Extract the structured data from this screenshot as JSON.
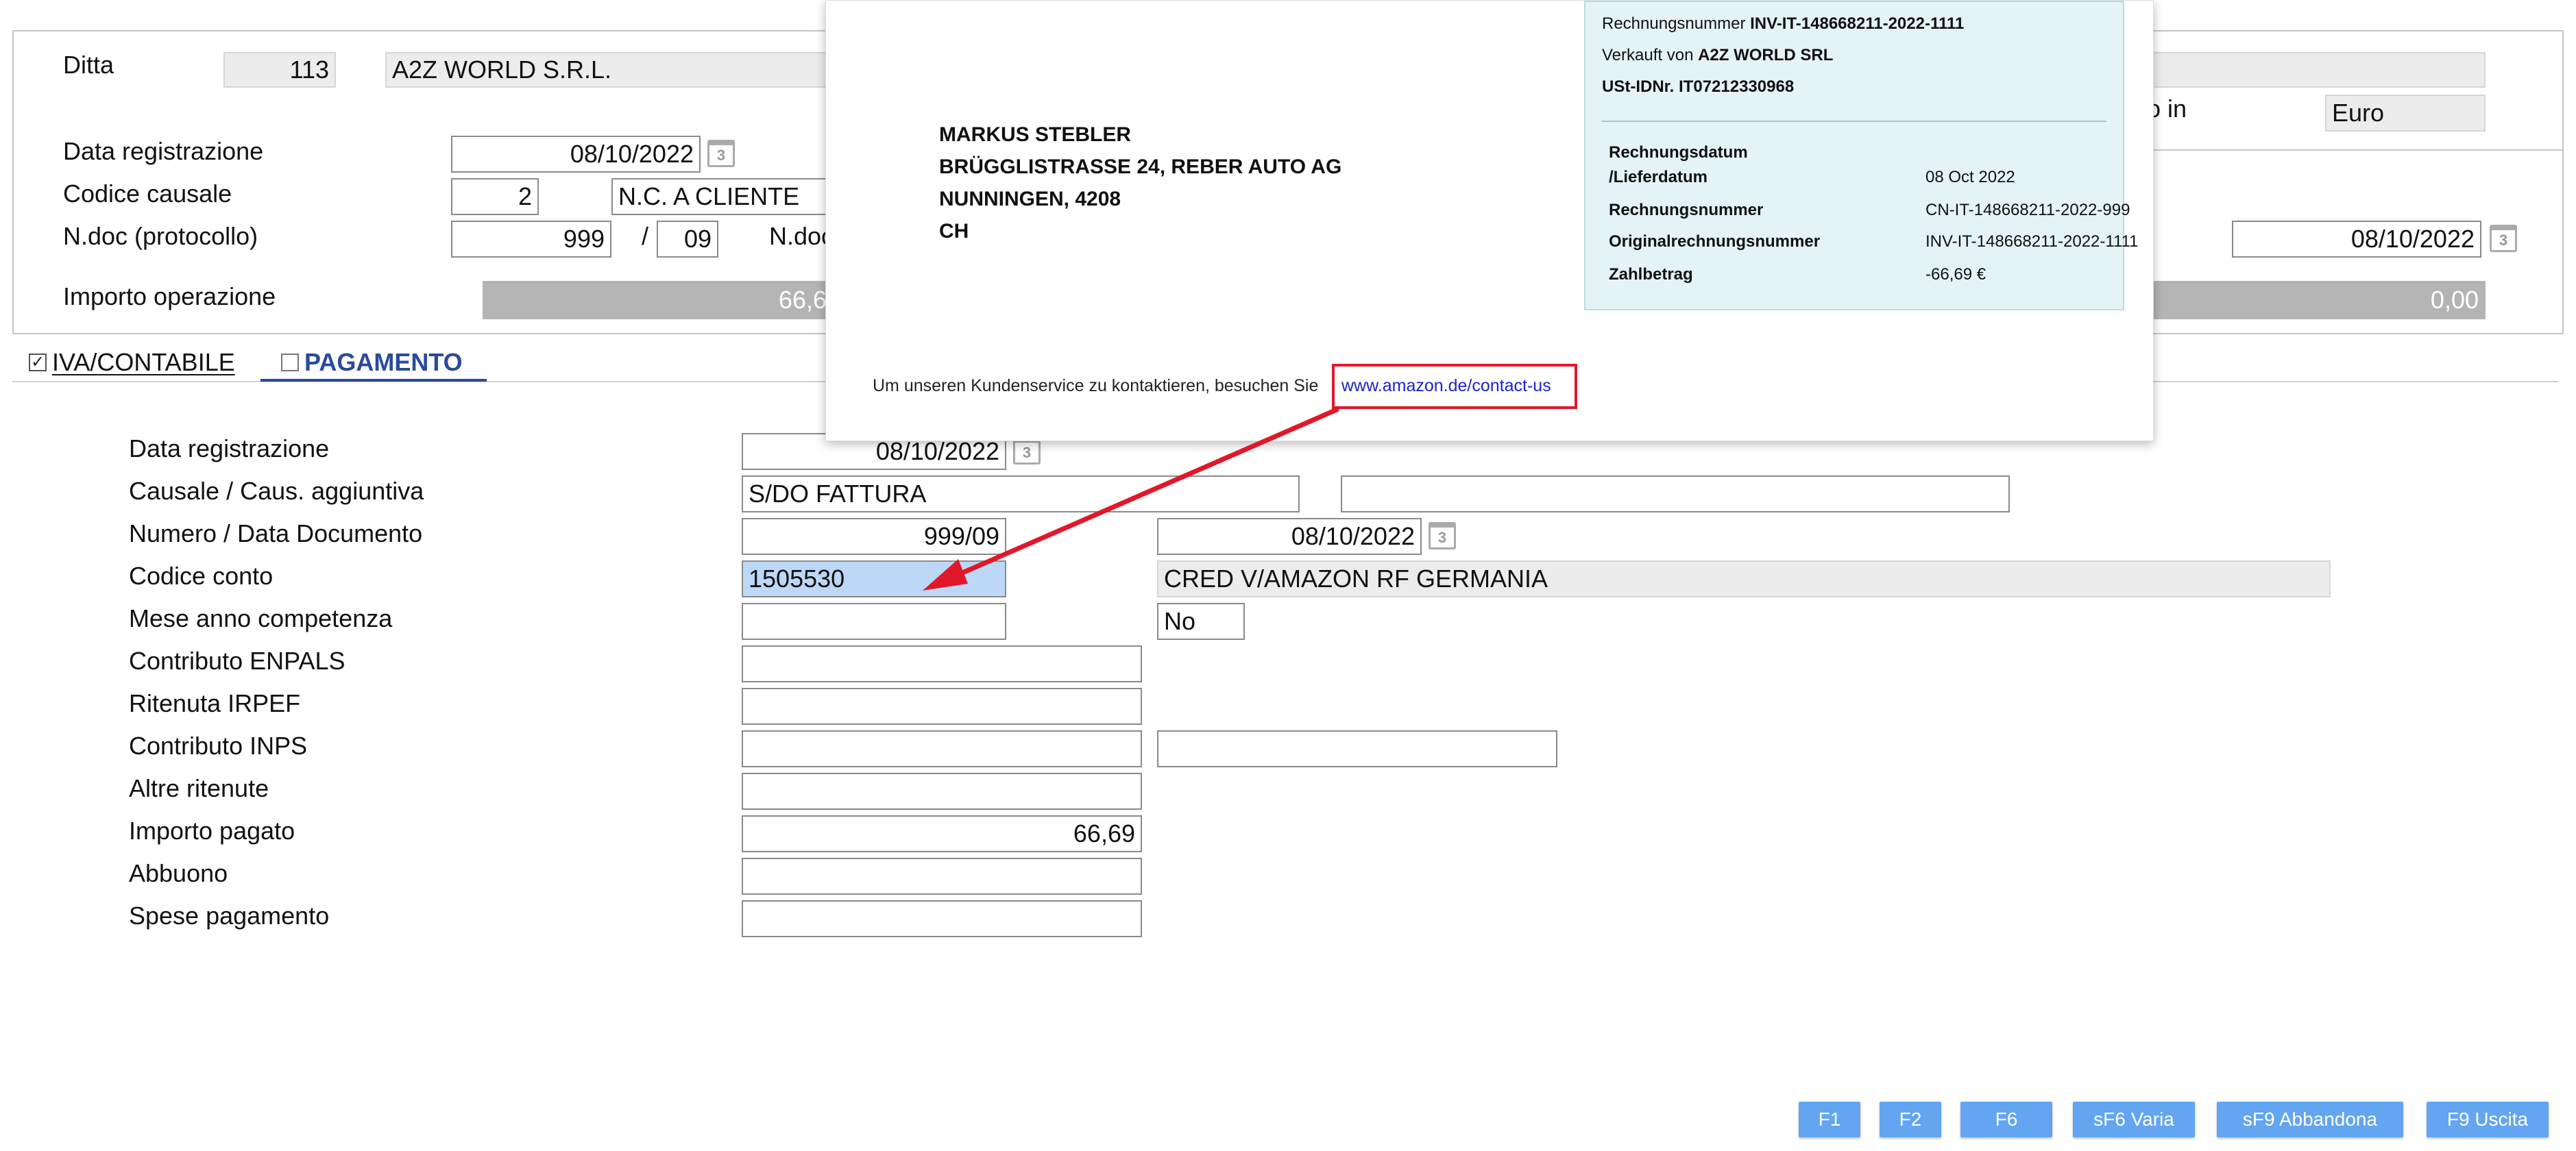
{
  "header": {
    "ditta_label": "Ditta",
    "ditta_code": "113",
    "ditta_name": "A2Z WORLD S.R.L.",
    "data_reg_label": "Data registrazione",
    "data_reg_value": "08/10/2022",
    "codice_causale_label": "Codice causale",
    "codice_causale_value": "2",
    "causale_desc": "N.C. A  CLIENTE",
    "ndoc_label": "N.doc (protocollo)",
    "ndoc_value": "999",
    "ndoc_sep": "/",
    "ndoc_suffix": "09",
    "ndoc_partial_label": "N.doc",
    "ndoc_date_value": "08/10/2022",
    "importo_label": "Importo operazione",
    "importo_value": "66,6",
    "importo_right_value": "0,00",
    "currency_label_partial": "o in",
    "currency_value": "Euro",
    "calendar_glyph": "3"
  },
  "tabs": [
    {
      "label": "IVA/CONTABILE",
      "checked": true
    },
    {
      "label": "PAGAMENTO",
      "checked": false,
      "active": true
    }
  ],
  "form": {
    "data_registrazione": {
      "label": "Data registrazione",
      "value": "08/10/2022"
    },
    "causale": {
      "label": "Causale / Caus. aggiuntiva",
      "value": "S/DO FATTURA",
      "value2": ""
    },
    "numero_data": {
      "label": "Numero / Data Documento",
      "value": "999/09",
      "date": "08/10/2022"
    },
    "codice_conto": {
      "label": "Codice conto",
      "value": "1505530",
      "desc": "CRED V/AMAZON RF GERMANIA"
    },
    "mese_anno": {
      "label": "Mese anno competenza",
      "value": "",
      "flag": "No"
    },
    "enpals": {
      "label": "Contributo ENPALS",
      "value": ""
    },
    "irpef": {
      "label": "Ritenuta IRPEF",
      "value": ""
    },
    "inps": {
      "label": "Contributo INPS",
      "value": "",
      "value2": ""
    },
    "altre": {
      "label": "Altre ritenute",
      "value": ""
    },
    "importo_pagato": {
      "label": "Importo pagato",
      "value": "66,69"
    },
    "abbuono": {
      "label": "Abbuono",
      "value": ""
    },
    "spese": {
      "label": "Spese pagamento",
      "value": ""
    }
  },
  "buttons": [
    "F1",
    "F2",
    "F6",
    "sF6 Varia",
    "sF9 Abbandona",
    "F9 Uscita"
  ],
  "invoice": {
    "address_lines": [
      "MARKUS STEBLER",
      "BRÜGGLISTRASSE 24, REBER AUTO AG",
      "NUNNINGEN, 4208",
      "CH"
    ],
    "box_top": [
      {
        "label": "Rechnungsnummer ",
        "value": "INV-IT-148668211-2022-1111"
      },
      {
        "label": "Verkauft von ",
        "value": "A2Z WORLD SRL"
      },
      {
        "label": "USt-IDNr. ",
        "value": "IT07212330968"
      }
    ],
    "details": [
      {
        "key": "Rechnungsdatum",
        "value": ""
      },
      {
        "key": "/Lieferdatum",
        "value": "08 Oct 2022"
      },
      {
        "key": "Rechnungsnummer",
        "value": "CN-IT-148668211-2022-999"
      },
      {
        "key": "Originalrechnungsnummer",
        "value": "INV-IT-148668211-2022-1111"
      },
      {
        "key": "Zahlbetrag",
        "value": "-66,69 €"
      }
    ],
    "footer_text": "Um unseren Kundenservice zu kontaktieren, besuchen Sie",
    "footer_link": "www.amazon.de/contact-us"
  },
  "colors": {
    "accent": "#63a5f0",
    "tab_active": "#2a4a9a",
    "annotation": "#e0182a",
    "selected_field": "#bcd8f6",
    "invoice_box": "#e4f3f5"
  }
}
